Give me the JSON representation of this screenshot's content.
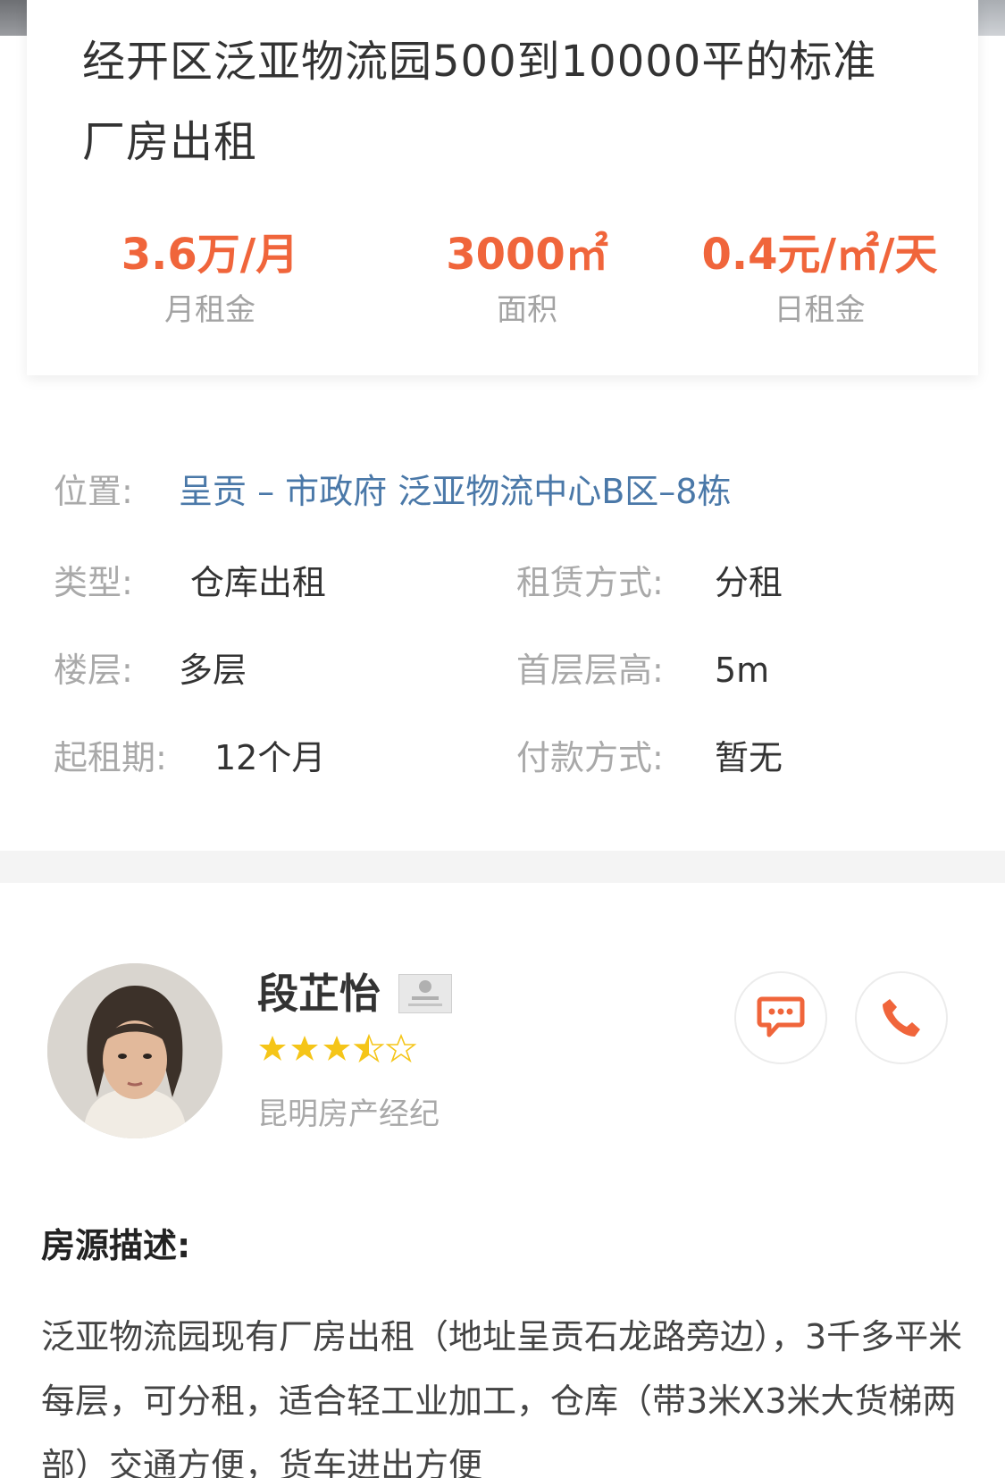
{
  "listing": {
    "title": "经开区泛亚物流园500到10000平的标准厂房出租",
    "stats": [
      {
        "value": "3.6万/月",
        "label": "月租金"
      },
      {
        "value": "3000㎡",
        "label": "面积"
      },
      {
        "value": "0.4元/㎡/天",
        "label": "日租金"
      }
    ]
  },
  "details": {
    "location_label": "位置:",
    "location_value": "呈贡 – 市政府 泛亚物流中心B区–8栋",
    "type_label": "类型:",
    "type_value": "仓库出租",
    "lease_label": "租赁方式:",
    "lease_value": "分租",
    "floor_label": "楼层:",
    "floor_value": "多层",
    "height_label": "首层层高:",
    "height_value": "5m",
    "term_label": "起租期:",
    "term_value": "12个月",
    "payment_label": "付款方式:",
    "payment_value": "暂无"
  },
  "agent": {
    "name": "段芷怡",
    "rating": 3.5,
    "rating_max": 5,
    "company": "昆明房产经纪",
    "icons": [
      "id-card-icon",
      "chat-icon",
      "phone-icon"
    ]
  },
  "description": {
    "title": "房源描述:",
    "text": "泛亚物流园现有厂房出租（地址呈贡石龙路旁边），3千多平米每层，可分租，适合轻工业加工，仓库（带3米X3米大货梯两部）交通方便，货车进出方便"
  },
  "colors": {
    "accent": "#f0653b",
    "link": "#4a78a8",
    "star": "#f5c518",
    "muted": "#a9a9a9"
  }
}
